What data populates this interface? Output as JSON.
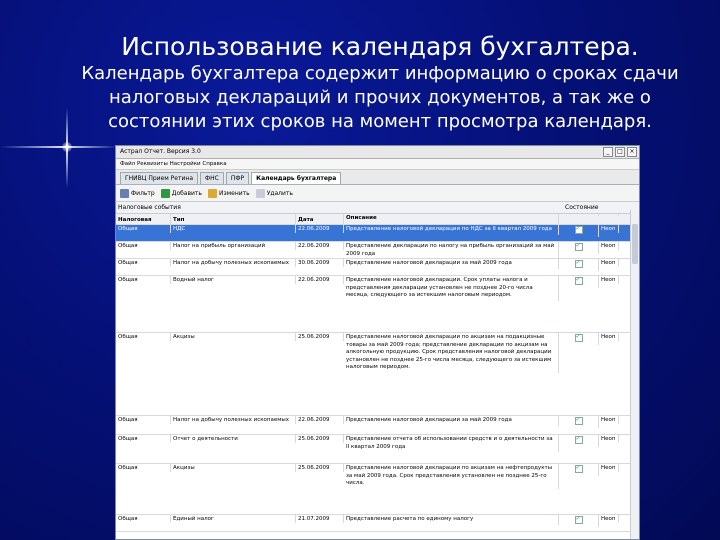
{
  "slide": {
    "title": "Использование календаря бухгалтера.",
    "subtitle": "Календарь бухгалтера содержит информацию о сроках сдачи налоговых деклараций и прочих документов, а так же о состоянии этих сроков на момент просмотра календаря."
  },
  "window": {
    "title": "Астрал Отчет. Версия 3.0",
    "menu": "Файл  Реквизиты  Настройки  Справка",
    "tabs": [
      "ГНИВЦ Прием Ретина",
      "ФНС",
      "ПФР",
      "Календарь бухгалтера"
    ],
    "toolbar": {
      "filter": "Фильтр",
      "add": "Добавить",
      "edit": "Изменить",
      "delete": "Удалить"
    },
    "section_left": "Налоговые события",
    "section_right": "Состояние",
    "columns": [
      "Налоговая",
      "Тип",
      "Дата",
      "Описание",
      "",
      ""
    ],
    "rows": [
      {
        "c1": "Общая",
        "c2": "НДС",
        "c3": "22.06.2009",
        "c4": "Представление налоговой декларации по НДС за II квартал 2009 года",
        "c6": "Неоп"
      },
      {
        "c1": "Общая",
        "c2": "Налог на прибыль организаций",
        "c3": "22.06.2009",
        "c4": "Представление декларации по налогу на прибыль организаций за май 2009 года",
        "c6": "Неоп"
      },
      {
        "c1": "Общая",
        "c2": "Налог на добычу полезных ископаемых",
        "c3": "30.06.2009",
        "c4": "Представление налоговой декларации за май 2009 года",
        "c6": "Неоп"
      },
      {
        "c1": "Общая",
        "c2": "Водный налог",
        "c3": "22.06.2009",
        "c4": "Представление налоговой декларации. Срок уплаты налога и представления декларации установлен не позднее 20-го числа месяца, следующего за истекшим налоговым периодом.",
        "c6": "Неоп"
      },
      {
        "c1": "Общая",
        "c2": "Акцизы",
        "c3": "25.06.2009",
        "c4": "Представление налоговой декларации по акцизам на подакцизные товары за май 2009 года; представление декларации по акцизам на алкогольную продукцию. Срок представления налоговой декларации установлен не позднее 25-го числа месяца, следующего за истекшим налоговым периодом.",
        "c6": "Неоп"
      },
      {
        "c1": "Общая",
        "c2": "Налог на добычу полезных ископаемых",
        "c3": "22.06.2009",
        "c4": "Представление налоговой декларации за май 2009 года",
        "c6": "Неоп"
      },
      {
        "c1": "Общая",
        "c2": "Отчет о деятельности",
        "c3": "25.06.2009",
        "c4": "Представление отчета об использовании средств и о деятельности за II квартал 2009 года",
        "c6": "Неоп"
      },
      {
        "c1": "Общая",
        "c2": "Акцизы",
        "c3": "25.06.2009",
        "c4": "Представление налоговой декларации по акцизам на нефтепродукты за май 2009 года. Срок представления установлен не позднее 25-го числа.",
        "c6": "Неоп"
      },
      {
        "c1": "Общая",
        "c2": "Единый налог",
        "c3": "21.07.2009",
        "c4": "Представление расчета по единому налогу",
        "c6": "Неоп"
      }
    ]
  }
}
